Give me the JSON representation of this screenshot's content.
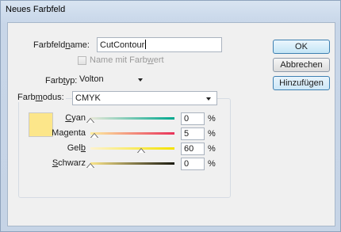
{
  "window": {
    "title": "Neues Farbfeld"
  },
  "name_field": {
    "label_pre": "Farbfeld",
    "label_u": "n",
    "label_post": "ame:",
    "value": "CutContour"
  },
  "name_with_value": {
    "label_pre": "Name mit Farb",
    "label_u": "w",
    "label_post": "ert",
    "checked": false,
    "enabled": false
  },
  "color_type": {
    "label_pre": "Farb",
    "label_u": "t",
    "label_post": "yp:",
    "value": "Volton"
  },
  "color_mode": {
    "label_pre": "Farb",
    "label_u": "m",
    "label_post": "odus:",
    "value": "CMYK"
  },
  "swatch_color": "#fce68a",
  "channels": [
    {
      "label_pre": "",
      "label_u": "C",
      "label_post": "yan",
      "value": "0",
      "unit": "%",
      "fraction": 0.0,
      "gradient_from": "#e8e8d8",
      "gradient_to": "#00a88e"
    },
    {
      "label_pre": "Ma",
      "label_u": "g",
      "label_post": "enta",
      "value": "5",
      "unit": "%",
      "fraction": 0.05,
      "gradient_from": "#fdeea0",
      "gradient_to": "#e8325a"
    },
    {
      "label_pre": "Gel",
      "label_u": "b",
      "label_post": "",
      "value": "60",
      "unit": "%",
      "fraction": 0.6,
      "gradient_from": "#fdf3d0",
      "gradient_to": "#f4e200"
    },
    {
      "label_pre": "",
      "label_u": "S",
      "label_post": "chwarz",
      "value": "0",
      "unit": "%",
      "fraction": 0.0,
      "gradient_from": "#fce68a",
      "gradient_to": "#1a1a10"
    }
  ],
  "buttons": {
    "ok": "OK",
    "cancel": "Abbrechen",
    "add": "Hinzufügen"
  }
}
